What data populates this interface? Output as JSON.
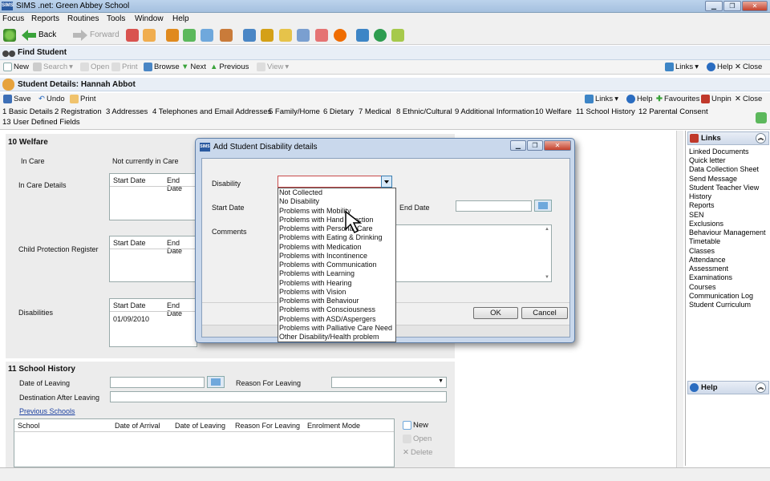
{
  "app": {
    "title": "SIMS .net: Green Abbey School"
  },
  "menu": [
    "Focus",
    "Reports",
    "Routines",
    "Tools",
    "Window",
    "Help"
  ],
  "toolbar": {
    "back": "Back",
    "forward": "Forward"
  },
  "find": {
    "title": "Find Student",
    "tools": {
      "new": "New",
      "search": "Search",
      "open": "Open",
      "print": "Print",
      "browse": "Browse",
      "next": "Next",
      "previous": "Previous",
      "view": "View"
    },
    "right": {
      "links": "Links",
      "help": "Help",
      "close": "Close"
    }
  },
  "details": {
    "title": "Student Details: Hannah Abbot",
    "tools": {
      "save": "Save",
      "undo": "Undo",
      "print": "Print"
    },
    "right": {
      "links": "Links",
      "help": "Help",
      "favourites": "Favourites",
      "unpin": "Unpin",
      "close": "Close"
    },
    "tabs": [
      "1 Basic Details",
      "2 Registration",
      "3 Addresses",
      "4 Telephones and Email Addresses",
      "5 Family/Home",
      "6 Dietary",
      "7 Medical",
      "8 Ethnic/Cultural",
      "9 Additional Information",
      "10 Welfare",
      "11 School History",
      "12 Parental Consent",
      "13 User Defined Fields"
    ]
  },
  "welfare": {
    "heading": "10 Welfare",
    "in_care_label": "In Care",
    "in_care_value": "Not currently in Care",
    "in_care_details_label": "In Care Details",
    "cpr_label": "Child Protection Register",
    "disabilities_label": "Disabilities",
    "grid_headers": [
      "Start Date",
      "End Date"
    ],
    "disability_row_start": "01/09/2010"
  },
  "school_history": {
    "heading": "11 School History",
    "date_of_leaving": "Date of Leaving",
    "reason_for_leaving": "Reason For Leaving",
    "destination": "Destination After Leaving",
    "previous_schools": "Previous Schools",
    "columns": [
      "School",
      "Date of Arrival",
      "Date of Leaving",
      "Reason For Leaving",
      "Enrolment Mode"
    ],
    "actions": {
      "new": "New",
      "open": "Open",
      "delete": "Delete"
    }
  },
  "links_panel": {
    "title": "Links",
    "items": [
      "Linked Documents",
      "Quick letter",
      "Data Collection Sheet",
      "Send Message",
      "Student Teacher View",
      "History",
      "Reports",
      "SEN",
      "Exclusions",
      "Behaviour Management",
      "Timetable",
      "Classes",
      "Attendance",
      "Assessment",
      "Examinations",
      "Courses",
      "Communication Log",
      "Student Curriculum"
    ]
  },
  "help_panel": {
    "title": "Help"
  },
  "dialog": {
    "title": "Add Student Disability details",
    "disability_label": "Disability",
    "start_date_label": "Start Date",
    "end_date_label": "End Date",
    "comments_label": "Comments",
    "ok": "OK",
    "cancel": "Cancel",
    "options": [
      "Not Collected",
      "No Disability",
      "Problems with Mobility",
      "Problems with Hand Function",
      "Problems with Personal Care",
      "Problems with Eating & Drinking",
      "Problems with Medication",
      "Problems with Incontinence",
      "Problems with Communication",
      "Problems with Learning",
      "Problems with Hearing",
      "Problems with Vision",
      "Problems with Behaviour",
      "Problems with Consciousness",
      "Problems with ASD/Aspergers",
      "Problems with Palliative Care Need",
      "Other Disability/Health problem"
    ]
  }
}
